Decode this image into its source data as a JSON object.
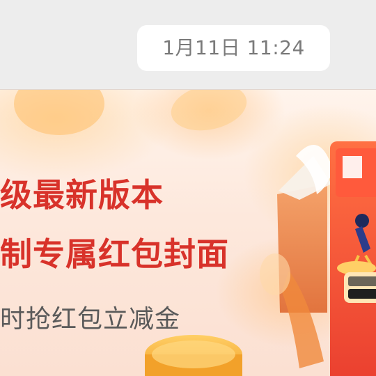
{
  "message": {
    "timestamp": "1月11日 11:24"
  },
  "promo": {
    "line1": "级最新版本",
    "line2": "制专属红包封面",
    "line3": "时抢红包立减金"
  },
  "colors": {
    "headline": "#d8322a",
    "subline": "#5a5a5a",
    "timestamp_text": "#7a7a7a",
    "chat_background": "#ededed"
  }
}
